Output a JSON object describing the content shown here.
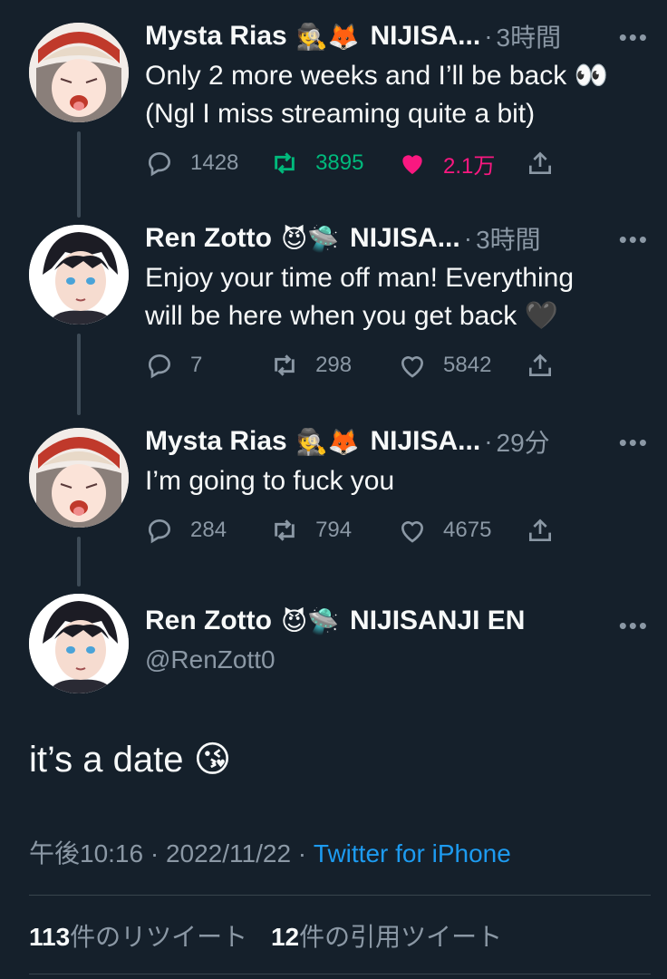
{
  "tweets": [
    {
      "name": "Mysta Rias",
      "emojis": "🕵️🦊",
      "org": "NIJISA...",
      "time": "3時間",
      "text_lines": [
        "Only 2 more weeks and I’ll be back 👀",
        "(Ngl I miss streaming quite a bit)"
      ],
      "replies": "1428",
      "retweets": "3895",
      "likes": "2.1万",
      "retweeted": true,
      "liked": true
    },
    {
      "name": "Ren Zotto",
      "emojis": "😈🛸",
      "org": "NIJISA...",
      "time": "3時間",
      "text_lines": [
        "Enjoy your time off man! Everything",
        "will be here when you get back 🖤"
      ],
      "replies": "7",
      "retweets": "298",
      "likes": "5842",
      "retweeted": false,
      "liked": false
    },
    {
      "name": "Mysta Rias",
      "emojis": "🕵️🦊",
      "org": "NIJISA...",
      "time": "29分",
      "text_lines": [
        "I’m going to fuck you"
      ],
      "replies": "284",
      "retweets": "794",
      "likes": "4675",
      "retweeted": false,
      "liked": false
    }
  ],
  "main": {
    "name": "Ren Zotto",
    "emojis": "😈🛸",
    "org": "NIJISANJI EN",
    "handle": "@RenZott0",
    "text": "it’s a date 😘",
    "time": "午後10:16 · 2022/11/22 · ",
    "source": "Twitter for iPhone",
    "retweet_count": "113",
    "retweet_label": "件のリツイート",
    "quote_count": "12",
    "quote_label": "件の引用ツイート"
  },
  "colors": {
    "background": "#15202b",
    "text": "#f7f9f9",
    "muted": "#8b98a5",
    "link": "#1d9bf0",
    "retweet": "#00ba7c",
    "like": "#f91880"
  },
  "icons": [
    "reply-icon",
    "retweet-icon",
    "like-icon",
    "share-icon",
    "more-icon"
  ]
}
